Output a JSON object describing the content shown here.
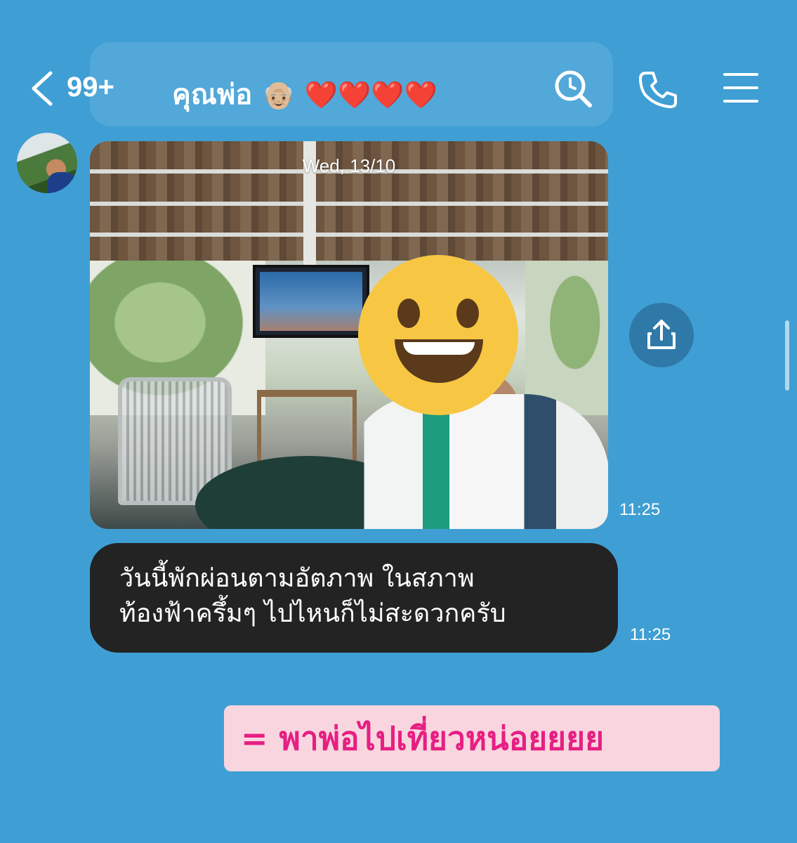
{
  "header": {
    "unread_count": "99+",
    "title": "คุณพ่อ",
    "title_emojis": "👴🏼 ❤️❤️❤️❤️"
  },
  "messages": {
    "photo": {
      "date_stamp": "Wed, 13/10",
      "time": "11:25"
    },
    "text": {
      "line1": "วันนี้พักผ่อนตามอัตภาพ ในสภาพ",
      "line2": "ท้องฟ้าครึ้มๆ ไปไหนก็ไม่สะดวกครับ",
      "time": "11:25"
    }
  },
  "caption": "= พาพ่อไปเที่ยวหน่อยยยย",
  "colors": {
    "background": "#3f9fd4",
    "bubble": "#232323",
    "caption_bg": "#f9d6df",
    "caption_text": "#e61f83",
    "share_button": "#2f79a8"
  },
  "icons": [
    "back-icon",
    "search-icon",
    "call-icon",
    "menu-icon",
    "share-icon"
  ]
}
